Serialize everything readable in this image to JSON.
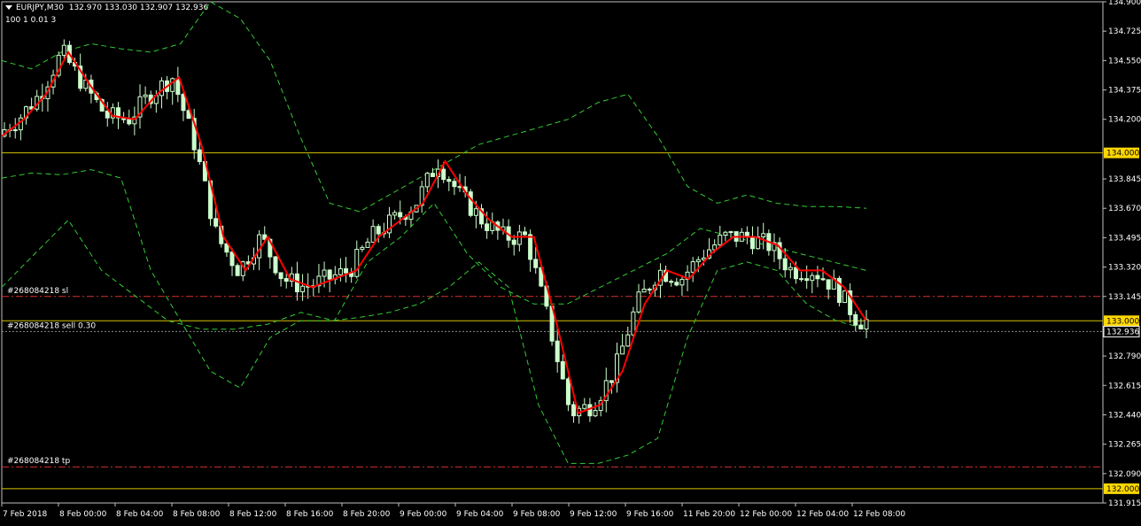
{
  "header": {
    "symbol": "EURJPY,M30",
    "ohlc": "132.970 133.030 132.907 132.936",
    "params": "100 1 0.01 3"
  },
  "colors": {
    "background": "#000000",
    "candle": "#ccffcc",
    "ma": "#ff0000",
    "bands": "#33cc33",
    "level": "#d4c200",
    "order": "#d93030",
    "price_tag": "#ffd700"
  },
  "chart_data": {
    "type": "candlestick",
    "symbol": "EURJPY",
    "timeframe": "M30",
    "ylim": [
      131.915,
      134.9
    ],
    "y_ticks": [
      "134.900",
      "134.725",
      "134.550",
      "134.375",
      "134.200",
      "133.845",
      "133.670",
      "133.495",
      "133.320",
      "133.145",
      "132.790",
      "132.615",
      "132.440",
      "132.265",
      "132.090",
      "131.915"
    ],
    "x_ticks": [
      "7 Feb 2018",
      "8 Feb 00:00",
      "8 Feb 04:00",
      "8 Feb 08:00",
      "8 Feb 12:00",
      "8 Feb 16:00",
      "8 Feb 20:00",
      "9 Feb 00:00",
      "9 Feb 04:00",
      "9 Feb 08:00",
      "9 Feb 12:00",
      "9 Feb 16:00",
      "11 Feb 20:00",
      "12 Feb 00:00",
      "12 Feb 04:00",
      "12 Feb 08:00"
    ],
    "levels": [
      {
        "label": "134.000",
        "value": 134.0
      },
      {
        "label": "133.000",
        "value": 133.0
      },
      {
        "label": "132.000",
        "value": 132.0
      }
    ],
    "current_price": {
      "label": "132.936",
      "value": 132.936
    },
    "orders": [
      {
        "label": "#268084218 sl",
        "value": 133.145
      },
      {
        "label": "#268084218 sell 0.30",
        "value": 132.936
      },
      {
        "label": "#268084218 tp",
        "value": 132.13
      }
    ],
    "ma_line": [
      134.1,
      134.2,
      134.35,
      134.6,
      134.4,
      134.22,
      134.2,
      134.35,
      134.45,
      134.05,
      133.5,
      133.3,
      133.5,
      133.25,
      133.2,
      133.25,
      133.3,
      133.5,
      133.6,
      133.7,
      133.95,
      133.75,
      133.6,
      133.5,
      133.5,
      133.0,
      132.45,
      132.5,
      132.7,
      133.1,
      133.3,
      133.25,
      133.4,
      133.5,
      133.5,
      133.45,
      133.3,
      133.3,
      133.2,
      133.0
    ],
    "upper_band": [
      134.55,
      134.5,
      134.6,
      134.65,
      134.62,
      134.6,
      134.65,
      134.9,
      134.8,
      134.55,
      134.1,
      133.7,
      133.65,
      133.75,
      133.85,
      133.95,
      134.05,
      134.1,
      134.15,
      134.2,
      134.3,
      134.35,
      134.1,
      133.8,
      133.7,
      133.75,
      133.7,
      133.68,
      133.68,
      133.67
    ],
    "lower_band": [
      133.85,
      133.88,
      133.87,
      133.9,
      133.85,
      133.3,
      133.0,
      132.7,
      132.6,
      132.9,
      133.0,
      133.0,
      133.02,
      133.05,
      133.1,
      133.2,
      133.35,
      133.2,
      132.5,
      132.15,
      132.15,
      132.2,
      132.3,
      132.9,
      133.3,
      133.35,
      133.3,
      133.1,
      133.0,
      132.95
    ],
    "middle_band": [
      133.2,
      133.4,
      133.6,
      133.3,
      133.15,
      133.0,
      132.95,
      132.95,
      132.98,
      133.05,
      133.0,
      133.35,
      133.5,
      133.7,
      133.4,
      133.2,
      133.1,
      133.1,
      133.2,
      133.3,
      133.4,
      133.55,
      133.5,
      133.45,
      133.4,
      133.35,
      133.3
    ]
  }
}
